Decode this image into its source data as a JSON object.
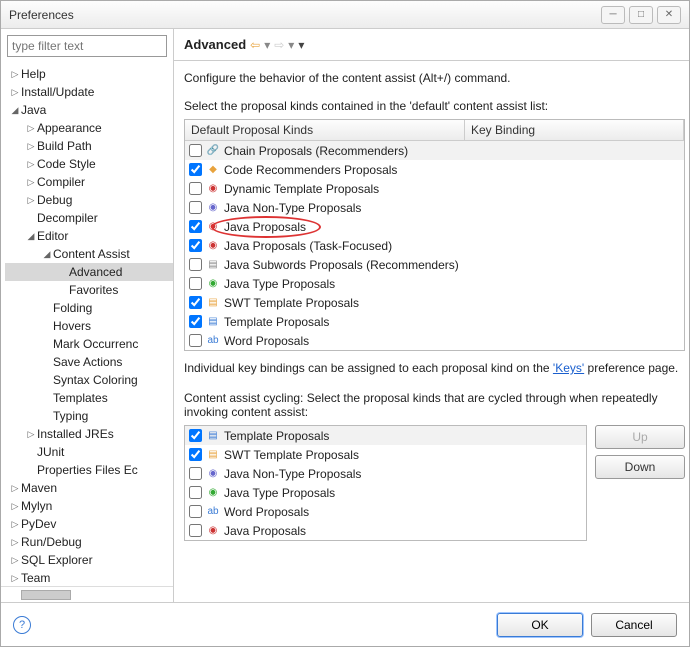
{
  "window": {
    "title": "Preferences"
  },
  "sidebar": {
    "filter_placeholder": "type filter text",
    "items": [
      {
        "label": "Help",
        "depth": 0,
        "exp": "▷"
      },
      {
        "label": "Install/Update",
        "depth": 0,
        "exp": "▷"
      },
      {
        "label": "Java",
        "depth": 0,
        "exp": "◢"
      },
      {
        "label": "Appearance",
        "depth": 1,
        "exp": "▷"
      },
      {
        "label": "Build Path",
        "depth": 1,
        "exp": "▷"
      },
      {
        "label": "Code Style",
        "depth": 1,
        "exp": "▷"
      },
      {
        "label": "Compiler",
        "depth": 1,
        "exp": "▷"
      },
      {
        "label": "Debug",
        "depth": 1,
        "exp": "▷"
      },
      {
        "label": "Decompiler",
        "depth": 1,
        "exp": ""
      },
      {
        "label": "Editor",
        "depth": 1,
        "exp": "◢"
      },
      {
        "label": "Content Assist",
        "depth": 2,
        "exp": "◢"
      },
      {
        "label": "Advanced",
        "depth": 3,
        "exp": "",
        "selected": true
      },
      {
        "label": "Favorites",
        "depth": 3,
        "exp": ""
      },
      {
        "label": "Folding",
        "depth": 2,
        "exp": ""
      },
      {
        "label": "Hovers",
        "depth": 2,
        "exp": ""
      },
      {
        "label": "Mark Occurrenc",
        "depth": 2,
        "exp": ""
      },
      {
        "label": "Save Actions",
        "depth": 2,
        "exp": ""
      },
      {
        "label": "Syntax Coloring",
        "depth": 2,
        "exp": ""
      },
      {
        "label": "Templates",
        "depth": 2,
        "exp": ""
      },
      {
        "label": "Typing",
        "depth": 2,
        "exp": ""
      },
      {
        "label": "Installed JREs",
        "depth": 1,
        "exp": "▷"
      },
      {
        "label": "JUnit",
        "depth": 1,
        "exp": ""
      },
      {
        "label": "Properties Files Ec",
        "depth": 1,
        "exp": ""
      },
      {
        "label": "Maven",
        "depth": 0,
        "exp": "▷"
      },
      {
        "label": "Mylyn",
        "depth": 0,
        "exp": "▷"
      },
      {
        "label": "PyDev",
        "depth": 0,
        "exp": "▷"
      },
      {
        "label": "Run/Debug",
        "depth": 0,
        "exp": "▷"
      },
      {
        "label": "SQL Explorer",
        "depth": 0,
        "exp": "▷"
      },
      {
        "label": "Team",
        "depth": 0,
        "exp": "▷"
      }
    ]
  },
  "main": {
    "heading": "Advanced",
    "desc": "Configure the behavior of the content assist (Alt+/) command.",
    "select_label": "Select the proposal kinds contained in the 'default' content assist list:",
    "col1": "Default Proposal Kinds",
    "col2": "Key Binding",
    "proposals": [
      {
        "checked": false,
        "icon": "🔗",
        "iconbg": "#7a7",
        "label": "Chain Proposals (Recommenders)",
        "sel": true
      },
      {
        "checked": true,
        "icon": "◆",
        "iconbg": "#e8a33d",
        "label": "Code Recommenders Proposals"
      },
      {
        "checked": false,
        "icon": "◉",
        "iconbg": "#c33",
        "label": "Dynamic Template Proposals"
      },
      {
        "checked": false,
        "icon": "◉",
        "iconbg": "#66c",
        "label": "Java Non-Type Proposals"
      },
      {
        "checked": true,
        "icon": "◉",
        "iconbg": "#c33",
        "label": "Java Proposals",
        "circled": true
      },
      {
        "checked": true,
        "icon": "◉",
        "iconbg": "#c33",
        "label": "Java Proposals (Task-Focused)"
      },
      {
        "checked": false,
        "icon": "▤",
        "iconbg": "#888",
        "label": "Java Subwords Proposals (Recommenders)"
      },
      {
        "checked": false,
        "icon": "◉",
        "iconbg": "#3a3",
        "label": "Java Type Proposals"
      },
      {
        "checked": true,
        "icon": "▤",
        "iconbg": "#e8a33d",
        "label": "SWT Template Proposals"
      },
      {
        "checked": true,
        "icon": "▤",
        "iconbg": "#3a7bd5",
        "label": "Template Proposals"
      },
      {
        "checked": false,
        "icon": "ab",
        "iconbg": "#3a7bd5",
        "label": "Word Proposals"
      }
    ],
    "note_pre": "Individual key bindings can be assigned to each proposal kind on the ",
    "note_link": "'Keys'",
    "note_post": " preference page.",
    "cycle_label": "Content assist cycling: Select the proposal kinds that are cycled through when repeatedly invoking content assist:",
    "cycle": [
      {
        "checked": true,
        "icon": "▤",
        "iconbg": "#3a7bd5",
        "label": "Template Proposals",
        "sel": true
      },
      {
        "checked": true,
        "icon": "▤",
        "iconbg": "#e8a33d",
        "label": "SWT Template Proposals"
      },
      {
        "checked": false,
        "icon": "◉",
        "iconbg": "#66c",
        "label": "Java Non-Type Proposals"
      },
      {
        "checked": false,
        "icon": "◉",
        "iconbg": "#3a3",
        "label": "Java Type Proposals"
      },
      {
        "checked": false,
        "icon": "ab",
        "iconbg": "#3a7bd5",
        "label": "Word Proposals"
      },
      {
        "checked": false,
        "icon": "◉",
        "iconbg": "#c33",
        "label": "Java Proposals"
      }
    ],
    "up": "Up",
    "down": "Down"
  },
  "footer": {
    "ok": "OK",
    "cancel": "Cancel"
  }
}
